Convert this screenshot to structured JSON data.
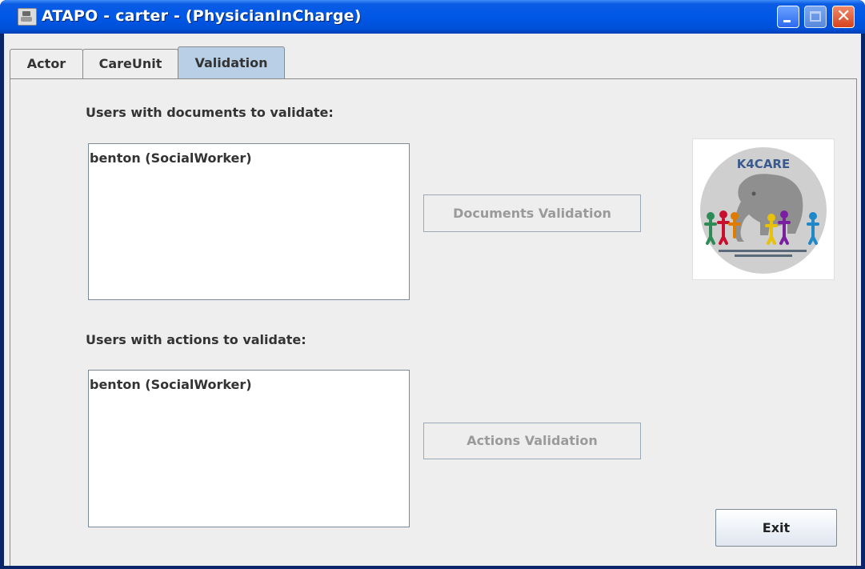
{
  "window": {
    "title": "ATAPO - carter - (PhysicianInCharge)",
    "controls": {
      "minimize": "minimize-icon",
      "maximize": "maximize-icon",
      "close": "close-icon"
    }
  },
  "tabs": [
    {
      "label": "Actor",
      "selected": false
    },
    {
      "label": "CareUnit",
      "selected": false
    },
    {
      "label": "Validation",
      "selected": true
    }
  ],
  "documents": {
    "heading": "Users with documents to validate:",
    "items": [
      "benton (SocialWorker)"
    ],
    "button_label": "Documents Validation",
    "button_enabled": false
  },
  "actions": {
    "heading": "Users with actions to validate:",
    "items": [
      "benton (SocialWorker)"
    ],
    "button_label": "Actions Validation",
    "button_enabled": false
  },
  "logo": {
    "text": "K4CARE",
    "icon": "k4care-elephant-logo"
  },
  "exit_label": "Exit",
  "colors": {
    "title_bar": "#0058e6",
    "selected_tab": "#b8cfe5",
    "panel": "#eeeeee",
    "disabled_text": "#9a9a9a"
  }
}
